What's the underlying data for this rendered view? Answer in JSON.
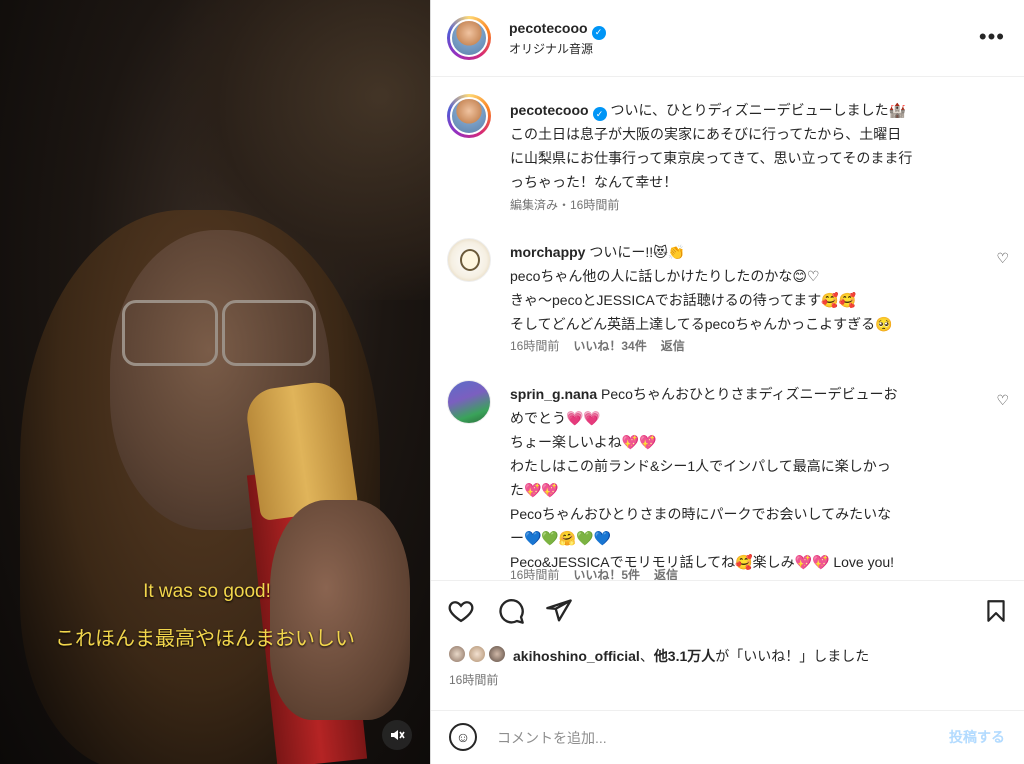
{
  "video": {
    "caption_en": "It was so good!",
    "caption_ja": "これほんま最高やほんまおいしい",
    "mute_icon": "volume-off-icon"
  },
  "header": {
    "username": "pecotecooo",
    "subtitle": "オリジナル音源"
  },
  "caption_post": {
    "username": "pecotecooo",
    "text": "ついに、ひとりディズニーデビューしました🏰",
    "line2": "この土日は息子が大阪の実家にあそびに行ってたから、土曜日",
    "line3": "に山梨県にお仕事行って東京戻ってきて、思い立ってそのまま行",
    "line4": "っちゃった！なんて幸せ！",
    "meta": "編集済み・16時間前"
  },
  "comments": [
    {
      "username": "morchappy",
      "lines": [
        "ついにー!!😻👏",
        "pecoちゃん他の人に話しかけたりしたのかな😊♡",
        "きゃ〜pecoとJESSICAでお話聴けるの待ってます🥰🥰",
        "そしてどんどん英語上達してるpecoちゃんかっこよすぎる🥺"
      ],
      "time": "16時間前",
      "likes": "いいね！34件",
      "reply": "返信"
    },
    {
      "username": "sprin_g.nana",
      "lines": [
        "Pecoちゃんおひとりさまディズニーデビューお",
        "めでとう💗💗",
        "ちょー楽しいよね💖💖",
        "わたしはこの前ランド&シー1人でインパして最高に楽しかっ",
        "た💖💖",
        "Pecoちゃんおひとりさまの時にパークでお会いしてみたいな",
        "ー💙💚🤗💚💙",
        "Peco&JESSICAでモリモリ話してね🥰楽しみ💖💖 Love you!"
      ],
      "time": "16時間前",
      "likes": "いいね！5件",
      "reply": "返信"
    }
  ],
  "likes_summary": {
    "account": "akihoshino_official",
    "sep": "、",
    "count": "他3.1万人",
    "suffix": "が「いいね！」しました"
  },
  "post_time": "16時間前",
  "composer": {
    "placeholder": "コメントを追加...",
    "post_label": "投稿する"
  },
  "colors": {
    "accent": "#0095f6",
    "post_button": "#b3dbff",
    "caption_yellow": "#f2d64c"
  }
}
